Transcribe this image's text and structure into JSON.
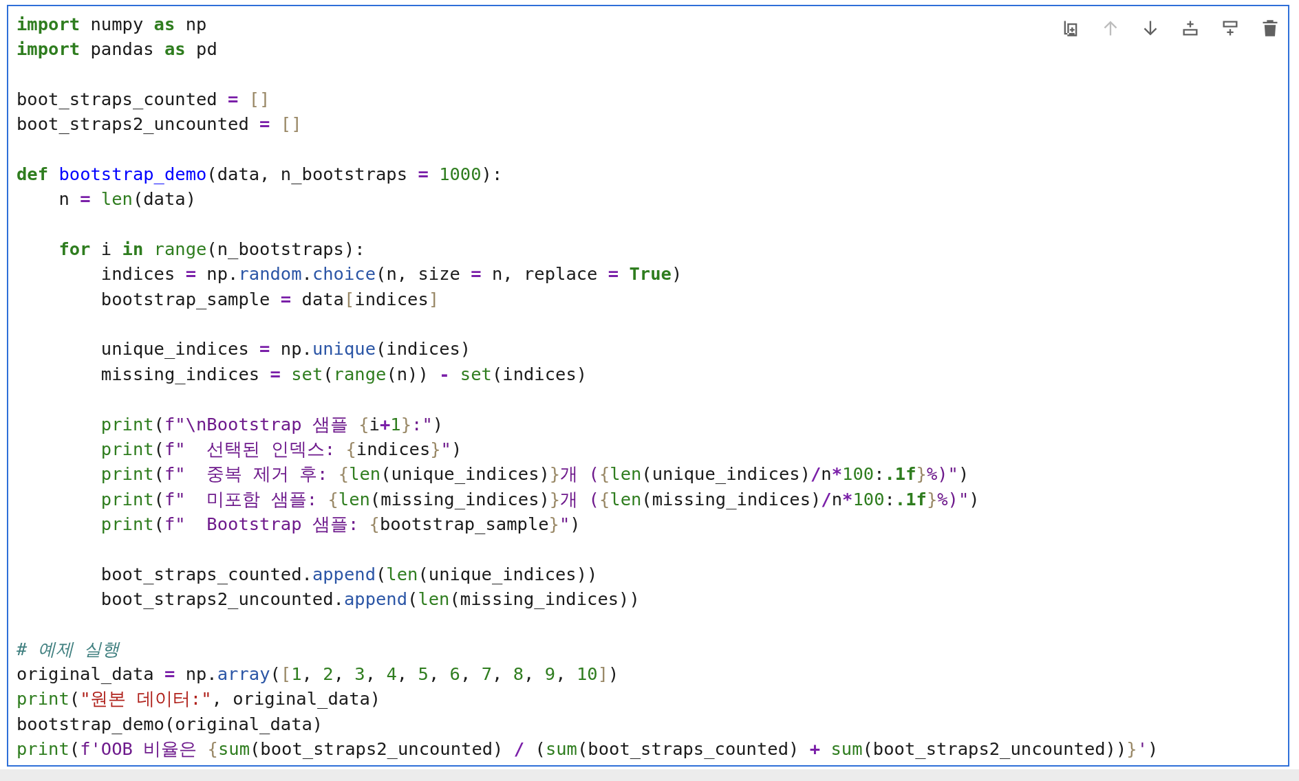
{
  "toolbar": [
    {
      "kind": "duplicate",
      "disabled": false
    },
    {
      "kind": "move-up",
      "disabled": true
    },
    {
      "kind": "move-down",
      "disabled": false
    },
    {
      "kind": "insert-above",
      "disabled": false
    },
    {
      "kind": "insert-below",
      "disabled": false
    },
    {
      "kind": "delete",
      "disabled": false
    }
  ],
  "code_lines": [
    {
      "kind": "code",
      "tokens": [
        {
          "kind": "keyword",
          "text": "import"
        },
        {
          "kind": "plain",
          "text": " numpy "
        },
        {
          "kind": "keyword",
          "text": "as"
        },
        {
          "kind": "plain",
          "text": " np"
        }
      ]
    },
    {
      "kind": "code",
      "tokens": [
        {
          "kind": "keyword",
          "text": "import"
        },
        {
          "kind": "plain",
          "text": " pandas "
        },
        {
          "kind": "keyword",
          "text": "as"
        },
        {
          "kind": "plain",
          "text": " pd"
        }
      ]
    },
    {
      "kind": "blank"
    },
    {
      "kind": "code",
      "tokens": [
        {
          "kind": "plain",
          "text": "boot_straps_counted "
        },
        {
          "kind": "operator",
          "text": "= "
        },
        {
          "kind": "bracket",
          "text": "[]"
        }
      ]
    },
    {
      "kind": "code",
      "tokens": [
        {
          "kind": "plain",
          "text": "boot_straps2_uncounted "
        },
        {
          "kind": "operator",
          "text": "= "
        },
        {
          "kind": "bracket",
          "text": "[]"
        }
      ]
    },
    {
      "kind": "blank"
    },
    {
      "kind": "code",
      "tokens": [
        {
          "kind": "keyword",
          "text": "def "
        },
        {
          "kind": "def",
          "text": "bootstrap_demo"
        },
        {
          "kind": "plain",
          "text": "(data, n_bootstraps "
        },
        {
          "kind": "operator",
          "text": "= "
        },
        {
          "kind": "number",
          "text": "1000"
        },
        {
          "kind": "plain",
          "text": "):"
        }
      ]
    },
    {
      "kind": "code",
      "tokens": [
        {
          "kind": "plain",
          "text": "    n "
        },
        {
          "kind": "operator",
          "text": "= "
        },
        {
          "kind": "builtin",
          "text": "len"
        },
        {
          "kind": "plain",
          "text": "(data)"
        }
      ]
    },
    {
      "kind": "blank"
    },
    {
      "kind": "code",
      "tokens": [
        {
          "kind": "keyword",
          "text": "    for"
        },
        {
          "kind": "plain",
          "text": " i "
        },
        {
          "kind": "keyword",
          "text": "in "
        },
        {
          "kind": "builtin",
          "text": "range"
        },
        {
          "kind": "plain",
          "text": "(n_bootstraps):"
        }
      ]
    },
    {
      "kind": "code",
      "tokens": [
        {
          "kind": "plain",
          "text": "        indices "
        },
        {
          "kind": "operator",
          "text": "="
        },
        {
          "kind": "plain",
          "text": " np."
        },
        {
          "kind": "attr",
          "text": "random"
        },
        {
          "kind": "plain",
          "text": "."
        },
        {
          "kind": "attr",
          "text": "choice"
        },
        {
          "kind": "plain",
          "text": "(n, size "
        },
        {
          "kind": "operator",
          "text": "="
        },
        {
          "kind": "plain",
          "text": " n, replace "
        },
        {
          "kind": "operator",
          "text": "= "
        },
        {
          "kind": "keyword",
          "text": "True"
        },
        {
          "kind": "plain",
          "text": ")"
        }
      ]
    },
    {
      "kind": "code",
      "tokens": [
        {
          "kind": "plain",
          "text": "        bootstrap_sample "
        },
        {
          "kind": "operator",
          "text": "="
        },
        {
          "kind": "plain",
          "text": " data"
        },
        {
          "kind": "bracket",
          "text": "["
        },
        {
          "kind": "plain",
          "text": "indices"
        },
        {
          "kind": "bracket",
          "text": "]"
        }
      ]
    },
    {
      "kind": "blank"
    },
    {
      "kind": "code",
      "tokens": [
        {
          "kind": "plain",
          "text": "        unique_indices "
        },
        {
          "kind": "operator",
          "text": "="
        },
        {
          "kind": "plain",
          "text": " np."
        },
        {
          "kind": "attr",
          "text": "unique"
        },
        {
          "kind": "plain",
          "text": "(indices)"
        }
      ]
    },
    {
      "kind": "code",
      "tokens": [
        {
          "kind": "plain",
          "text": "        missing_indices "
        },
        {
          "kind": "operator",
          "text": "= "
        },
        {
          "kind": "builtin",
          "text": "set"
        },
        {
          "kind": "plain",
          "text": "("
        },
        {
          "kind": "builtin",
          "text": "range"
        },
        {
          "kind": "plain",
          "text": "(n)) "
        },
        {
          "kind": "operator",
          "text": "- "
        },
        {
          "kind": "builtin",
          "text": "set"
        },
        {
          "kind": "plain",
          "text": "(indices)"
        }
      ]
    },
    {
      "kind": "blank"
    },
    {
      "kind": "code",
      "tokens": [
        {
          "kind": "builtin",
          "text": "        print"
        },
        {
          "kind": "plain",
          "text": "("
        },
        {
          "kind": "fstring",
          "text": "f\"\\nBootstrap 샘플 "
        },
        {
          "kind": "bracket",
          "text": "{"
        },
        {
          "kind": "plain",
          "text": "i"
        },
        {
          "kind": "operator",
          "text": "+"
        },
        {
          "kind": "number",
          "text": "1"
        },
        {
          "kind": "bracket",
          "text": "}"
        },
        {
          "kind": "fstring",
          "text": ":\""
        },
        {
          "kind": "plain",
          "text": ")"
        }
      ]
    },
    {
      "kind": "code",
      "tokens": [
        {
          "kind": "builtin",
          "text": "        print"
        },
        {
          "kind": "plain",
          "text": "("
        },
        {
          "kind": "fstring",
          "text": "f\"  선택된 인덱스: "
        },
        {
          "kind": "bracket",
          "text": "{"
        },
        {
          "kind": "plain",
          "text": "indices"
        },
        {
          "kind": "bracket",
          "text": "}"
        },
        {
          "kind": "fstring",
          "text": "\""
        },
        {
          "kind": "plain",
          "text": ")"
        }
      ]
    },
    {
      "kind": "code",
      "tokens": [
        {
          "kind": "builtin",
          "text": "        print"
        },
        {
          "kind": "plain",
          "text": "("
        },
        {
          "kind": "fstring",
          "text": "f\"  중복 제거 후: "
        },
        {
          "kind": "bracket",
          "text": "{"
        },
        {
          "kind": "builtin",
          "text": "len"
        },
        {
          "kind": "plain",
          "text": "(unique_indices)"
        },
        {
          "kind": "bracket",
          "text": "}"
        },
        {
          "kind": "fstring",
          "text": "개 ("
        },
        {
          "kind": "bracket",
          "text": "{"
        },
        {
          "kind": "builtin",
          "text": "len"
        },
        {
          "kind": "plain",
          "text": "(unique_indices)"
        },
        {
          "kind": "operator",
          "text": "/"
        },
        {
          "kind": "plain",
          "text": "n"
        },
        {
          "kind": "operator",
          "text": "*"
        },
        {
          "kind": "number",
          "text": "100"
        },
        {
          "kind": "plain",
          "text": ":"
        },
        {
          "kind": "format",
          "text": ".1f"
        },
        {
          "kind": "bracket",
          "text": "}"
        },
        {
          "kind": "fstring",
          "text": "%)\""
        },
        {
          "kind": "plain",
          "text": ")"
        }
      ]
    },
    {
      "kind": "code",
      "tokens": [
        {
          "kind": "builtin",
          "text": "        print"
        },
        {
          "kind": "plain",
          "text": "("
        },
        {
          "kind": "fstring",
          "text": "f\"  미포함 샘플: "
        },
        {
          "kind": "bracket",
          "text": "{"
        },
        {
          "kind": "builtin",
          "text": "len"
        },
        {
          "kind": "plain",
          "text": "(missing_indices)"
        },
        {
          "kind": "bracket",
          "text": "}"
        },
        {
          "kind": "fstring",
          "text": "개 ("
        },
        {
          "kind": "bracket",
          "text": "{"
        },
        {
          "kind": "builtin",
          "text": "len"
        },
        {
          "kind": "plain",
          "text": "(missing_indices)"
        },
        {
          "kind": "operator",
          "text": "/"
        },
        {
          "kind": "plain",
          "text": "n"
        },
        {
          "kind": "operator",
          "text": "*"
        },
        {
          "kind": "number",
          "text": "100"
        },
        {
          "kind": "plain",
          "text": ":"
        },
        {
          "kind": "format",
          "text": ".1f"
        },
        {
          "kind": "bracket",
          "text": "}"
        },
        {
          "kind": "fstring",
          "text": "%)\""
        },
        {
          "kind": "plain",
          "text": ")"
        }
      ]
    },
    {
      "kind": "code",
      "tokens": [
        {
          "kind": "builtin",
          "text": "        print"
        },
        {
          "kind": "plain",
          "text": "("
        },
        {
          "kind": "fstring",
          "text": "f\"  Bootstrap 샘플: "
        },
        {
          "kind": "bracket",
          "text": "{"
        },
        {
          "kind": "plain",
          "text": "bootstrap_sample"
        },
        {
          "kind": "bracket",
          "text": "}"
        },
        {
          "kind": "fstring",
          "text": "\""
        },
        {
          "kind": "plain",
          "text": ")"
        }
      ]
    },
    {
      "kind": "blank"
    },
    {
      "kind": "code",
      "tokens": [
        {
          "kind": "plain",
          "text": "        boot_straps_counted."
        },
        {
          "kind": "attr",
          "text": "append"
        },
        {
          "kind": "plain",
          "text": "("
        },
        {
          "kind": "builtin",
          "text": "len"
        },
        {
          "kind": "plain",
          "text": "(unique_indices))"
        }
      ]
    },
    {
      "kind": "code",
      "tokens": [
        {
          "kind": "plain",
          "text": "        boot_straps2_uncounted."
        },
        {
          "kind": "attr",
          "text": "append"
        },
        {
          "kind": "plain",
          "text": "("
        },
        {
          "kind": "builtin",
          "text": "len"
        },
        {
          "kind": "plain",
          "text": "(missing_indices))"
        }
      ]
    },
    {
      "kind": "blank"
    },
    {
      "kind": "code",
      "tokens": [
        {
          "kind": "comment",
          "text": "# 예제 실행"
        }
      ]
    },
    {
      "kind": "code",
      "tokens": [
        {
          "kind": "plain",
          "text": "original_data "
        },
        {
          "kind": "operator",
          "text": "="
        },
        {
          "kind": "plain",
          "text": " np."
        },
        {
          "kind": "attr",
          "text": "array"
        },
        {
          "kind": "plain",
          "text": "("
        },
        {
          "kind": "bracket",
          "text": "["
        },
        {
          "kind": "number",
          "text": "1"
        },
        {
          "kind": "plain",
          "text": ", "
        },
        {
          "kind": "number",
          "text": "2"
        },
        {
          "kind": "plain",
          "text": ", "
        },
        {
          "kind": "number",
          "text": "3"
        },
        {
          "kind": "plain",
          "text": ", "
        },
        {
          "kind": "number",
          "text": "4"
        },
        {
          "kind": "plain",
          "text": ", "
        },
        {
          "kind": "number",
          "text": "5"
        },
        {
          "kind": "plain",
          "text": ", "
        },
        {
          "kind": "number",
          "text": "6"
        },
        {
          "kind": "plain",
          "text": ", "
        },
        {
          "kind": "number",
          "text": "7"
        },
        {
          "kind": "plain",
          "text": ", "
        },
        {
          "kind": "number",
          "text": "8"
        },
        {
          "kind": "plain",
          "text": ", "
        },
        {
          "kind": "number",
          "text": "9"
        },
        {
          "kind": "plain",
          "text": ", "
        },
        {
          "kind": "number",
          "text": "10"
        },
        {
          "kind": "bracket",
          "text": "]"
        },
        {
          "kind": "plain",
          "text": ")"
        }
      ]
    },
    {
      "kind": "code",
      "tokens": [
        {
          "kind": "builtin",
          "text": "print"
        },
        {
          "kind": "plain",
          "text": "("
        },
        {
          "kind": "string",
          "text": "\"원본 데이터:\""
        },
        {
          "kind": "plain",
          "text": ", original_data)"
        }
      ]
    },
    {
      "kind": "code",
      "tokens": [
        {
          "kind": "plain",
          "text": "bootstrap_demo(original_data)"
        }
      ]
    },
    {
      "kind": "code",
      "tokens": [
        {
          "kind": "builtin",
          "text": "print"
        },
        {
          "kind": "plain",
          "text": "("
        },
        {
          "kind": "fstring",
          "text": "f'OOB 비율은 "
        },
        {
          "kind": "bracket",
          "text": "{"
        },
        {
          "kind": "builtin",
          "text": "sum"
        },
        {
          "kind": "plain",
          "text": "(boot_straps2_uncounted) "
        },
        {
          "kind": "operator",
          "text": "/"
        },
        {
          "kind": "plain",
          "text": " ("
        },
        {
          "kind": "builtin",
          "text": "sum"
        },
        {
          "kind": "plain",
          "text": "(boot_straps_counted) "
        },
        {
          "kind": "operator",
          "text": "+ "
        },
        {
          "kind": "builtin",
          "text": "sum"
        },
        {
          "kind": "plain",
          "text": "(boot_straps2_uncounted))"
        },
        {
          "kind": "bracket",
          "text": "}"
        },
        {
          "kind": "fstring",
          "text": "'"
        },
        {
          "kind": "plain",
          "text": ")"
        }
      ]
    }
  ]
}
